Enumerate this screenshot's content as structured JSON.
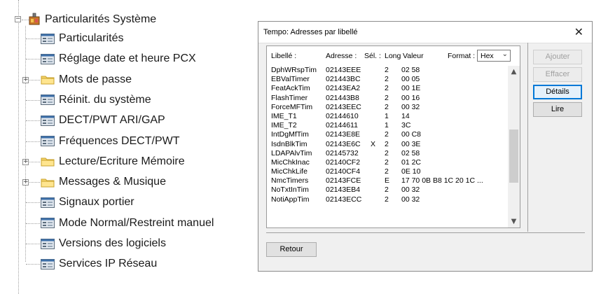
{
  "tree": {
    "root_label": "Particularités Système",
    "items": [
      {
        "label": "Particularités",
        "type": "doc",
        "expandable": false
      },
      {
        "label": "Réglage date et heure PCX",
        "type": "doc",
        "expandable": false
      },
      {
        "label": "Mots de passe",
        "type": "folder",
        "expandable": true
      },
      {
        "label": "Réinit. du système",
        "type": "doc",
        "expandable": false
      },
      {
        "label": "DECT/PWT ARI/GAP",
        "type": "doc",
        "expandable": false
      },
      {
        "label": "Fréquences DECT/PWT",
        "type": "doc",
        "expandable": false
      },
      {
        "label": "Lecture/Ecriture Mémoire",
        "type": "folder",
        "expandable": true
      },
      {
        "label": "Messages & Musique",
        "type": "folder",
        "expandable": true
      },
      {
        "label": "Signaux portier",
        "type": "doc",
        "expandable": false
      },
      {
        "label": "Mode Normal/Restreint manuel",
        "type": "doc",
        "expandable": false
      },
      {
        "label": "Versions des logiciels",
        "type": "doc",
        "expandable": false
      },
      {
        "label": "Services IP Réseau",
        "type": "doc",
        "expandable": false
      }
    ]
  },
  "dialog": {
    "title": "Tempo: Adresses par libellé",
    "close_label": "✕",
    "columns": {
      "libelle": "Libellé :",
      "adresse": "Adresse :",
      "sel": "Sél. :",
      "long": "Long",
      "valeur": "Valeur",
      "format": "Format :"
    },
    "format_value": "Hex",
    "rows": [
      {
        "libelle": "DphWRspTim",
        "adresse": "02143EEE",
        "sel": "",
        "long": "2",
        "valeur": "02  58"
      },
      {
        "libelle": "EBValTimer",
        "adresse": "021443BC",
        "sel": "",
        "long": "2",
        "valeur": "00  05"
      },
      {
        "libelle": "FeatAckTim",
        "adresse": "02143EA2",
        "sel": "",
        "long": "2",
        "valeur": "00  1E"
      },
      {
        "libelle": "FlashTimer",
        "adresse": "021443B8",
        "sel": "",
        "long": "2",
        "valeur": "00  16"
      },
      {
        "libelle": "ForceMFTim",
        "adresse": "02143EEC",
        "sel": "",
        "long": "2",
        "valeur": "00  32"
      },
      {
        "libelle": "IME_T1",
        "adresse": "02144610",
        "sel": "",
        "long": "1",
        "valeur": "14"
      },
      {
        "libelle": "IME_T2",
        "adresse": "02144611",
        "sel": "",
        "long": "1",
        "valeur": "3C"
      },
      {
        "libelle": "IntDgMfTim",
        "adresse": "02143E8E",
        "sel": "",
        "long": "2",
        "valeur": "00  C8"
      },
      {
        "libelle": "IsdnBlkTim",
        "adresse": "02143E6C",
        "sel": "X",
        "long": "2",
        "valeur": "00  3E"
      },
      {
        "libelle": "LDAPAlvTim",
        "adresse": "02145732",
        "sel": "",
        "long": "2",
        "valeur": "02  58"
      },
      {
        "libelle": "MicChkInac",
        "adresse": "02140CF2",
        "sel": "",
        "long": "2",
        "valeur": "01  2C"
      },
      {
        "libelle": "MicChkLife",
        "adresse": "02140CF4",
        "sel": "",
        "long": "2",
        "valeur": "0E  10"
      },
      {
        "libelle": "NmcTimers",
        "adresse": "02143FCE",
        "sel": "",
        "long": "E",
        "valeur": "17  70  0B  B8  1C  20  1C ..."
      },
      {
        "libelle": "NoTxtInTim",
        "adresse": "02143EB4",
        "sel": "",
        "long": "2",
        "valeur": "00  32"
      },
      {
        "libelle": "NotiAppTim",
        "adresse": "02143ECC",
        "sel": "",
        "long": "2",
        "valeur": "00  32"
      }
    ],
    "buttons": {
      "ajouter": "Ajouter",
      "effacer": "Effacer",
      "details": "Détails",
      "lire": "Lire",
      "retour": "Retour"
    }
  }
}
